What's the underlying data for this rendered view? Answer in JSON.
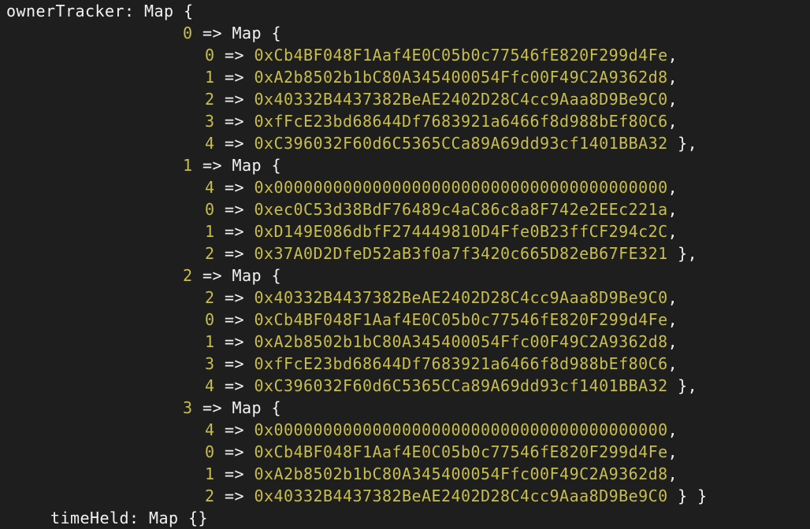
{
  "colors": {
    "background": "#1e1e1e",
    "text": "#f2f2f2",
    "value": "#c8bd4f"
  },
  "root": {
    "name": "ownerTracker",
    "open": ": Map {"
  },
  "groups": [
    {
      "key": "0",
      "entries": [
        {
          "k": "0",
          "v": "0xCb4BF048F1Aaf4E0C05b0c77546fE820F299d4Fe",
          "tail": ","
        },
        {
          "k": "1",
          "v": "0xA2b8502b1bC80A345400054Ffc00F49C2A9362d8",
          "tail": ","
        },
        {
          "k": "2",
          "v": "0x40332B4437382BeAE2402D28C4cc9Aaa8D9Be9C0",
          "tail": ","
        },
        {
          "k": "3",
          "v": "0xfFcE23bd68644Df7683921a6466f8d988bEf80C6",
          "tail": ","
        },
        {
          "k": "4",
          "v": "0xC396032F60d6C5365CCa89A69dd93cf1401BBA32",
          "tail": " },"
        }
      ]
    },
    {
      "key": "1",
      "entries": [
        {
          "k": "4",
          "v": "0x0000000000000000000000000000000000000000",
          "tail": ","
        },
        {
          "k": "0",
          "v": "0xec0C53d38BdF76489c4aC86c8a8F742e2EEc221a",
          "tail": ","
        },
        {
          "k": "1",
          "v": "0xD149E086dbfF274449810D4Ffe0B23ffCF294c2C",
          "tail": ","
        },
        {
          "k": "2",
          "v": "0x37A0D2DfeD52aB3f0a7f3420c665D82eB67FE321",
          "tail": " },"
        }
      ]
    },
    {
      "key": "2",
      "entries": [
        {
          "k": "2",
          "v": "0x40332B4437382BeAE2402D28C4cc9Aaa8D9Be9C0",
          "tail": ","
        },
        {
          "k": "0",
          "v": "0xCb4BF048F1Aaf4E0C05b0c77546fE820F299d4Fe",
          "tail": ","
        },
        {
          "k": "1",
          "v": "0xA2b8502b1bC80A345400054Ffc00F49C2A9362d8",
          "tail": ","
        },
        {
          "k": "3",
          "v": "0xfFcE23bd68644Df7683921a6466f8d988bEf80C6",
          "tail": ","
        },
        {
          "k": "4",
          "v": "0xC396032F60d6C5365CCa89A69dd93cf1401BBA32",
          "tail": " },"
        }
      ]
    },
    {
      "key": "3",
      "entries": [
        {
          "k": "4",
          "v": "0x0000000000000000000000000000000000000000",
          "tail": ","
        },
        {
          "k": "0",
          "v": "0xCb4BF048F1Aaf4E0C05b0c77546fE820F299d4Fe",
          "tail": ","
        },
        {
          "k": "1",
          "v": "0xA2b8502b1bC80A345400054Ffc00F49C2A9362d8",
          "tail": ","
        },
        {
          "k": "2",
          "v": "0x40332B4437382BeAE2402D28C4cc9Aaa8D9Be9C0",
          "tail": " } }"
        }
      ]
    }
  ],
  "tokens": {
    "arrow": " => ",
    "map_open": "Map {"
  },
  "next": {
    "text": "timeHeld: Map {}"
  }
}
